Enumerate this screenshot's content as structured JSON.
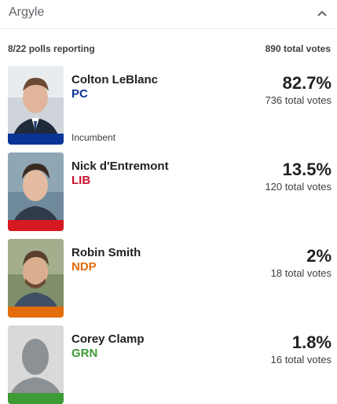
{
  "header": {
    "title": "Argyle",
    "collapse_icon": "chevron-up-icon"
  },
  "summary": {
    "reporting": "8/22 polls reporting",
    "total_votes": "890 total votes"
  },
  "candidates": [
    {
      "name": "Colton LeBlanc",
      "party": "PC",
      "party_color": "#0a3596",
      "percent": "82.7%",
      "votes": "736 total votes",
      "note": "Incumbent"
    },
    {
      "name": "Nick d'Entremont",
      "party": "LIB",
      "party_color": "#c8102e",
      "percent": "13.5%",
      "votes": "120 total votes",
      "note": ""
    },
    {
      "name": "Robin Smith",
      "party": "NDP",
      "party_color": "#e46c0a",
      "percent": "2%",
      "votes": "18 total votes",
      "note": ""
    },
    {
      "name": "Corey Clamp",
      "party": "GRN",
      "party_color": "#3d9b35",
      "percent": "1.8%",
      "votes": "16 total votes",
      "note": ""
    }
  ]
}
